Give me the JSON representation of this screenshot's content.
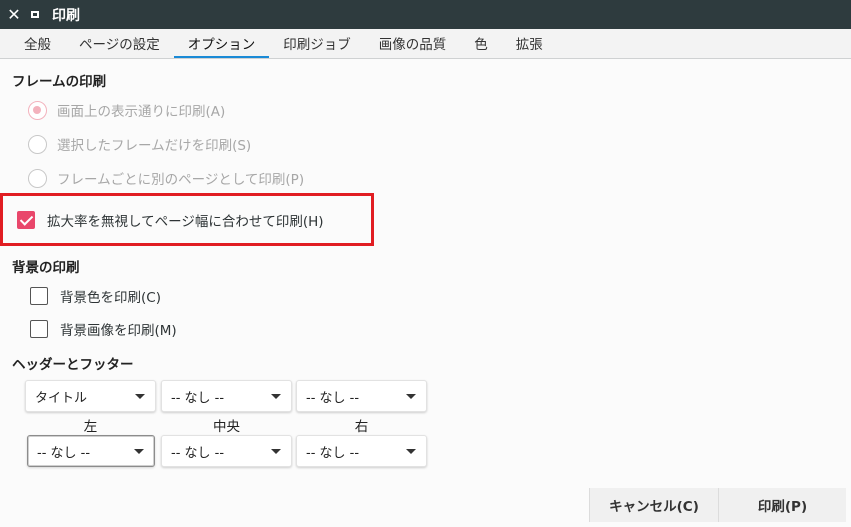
{
  "window": {
    "title": "印刷"
  },
  "tabs": [
    {
      "label": "全般"
    },
    {
      "label": "ページの設定"
    },
    {
      "label": "オプション"
    },
    {
      "label": "印刷ジョブ"
    },
    {
      "label": "画像の品質"
    },
    {
      "label": "色"
    },
    {
      "label": "拡張"
    }
  ],
  "frames": {
    "title": "フレームの印刷",
    "options": [
      {
        "label": "画面上の表示通りに印刷(A)",
        "checked": true
      },
      {
        "label": "選択したフレームだけを印刷(S)",
        "checked": false
      },
      {
        "label": "フレームごとに別のページとして印刷(P)",
        "checked": false
      }
    ]
  },
  "shrink_to_fit": {
    "label": "拡大率を無視してページ幅に合わせて印刷(H)",
    "checked": true
  },
  "background": {
    "title": "背景の印刷",
    "colors_label": "背景色を印刷(C)",
    "images_label": "背景画像を印刷(M)"
  },
  "header_footer": {
    "title": "ヘッダーとフッター",
    "header": [
      "タイトル",
      "-- なし --",
      "-- なし --"
    ],
    "columns": [
      "左",
      "中央",
      "右"
    ],
    "footer": [
      "-- なし --",
      "-- なし --",
      "-- なし --"
    ]
  },
  "buttons": {
    "cancel": "キャンセル(C)",
    "print": "印刷(P)"
  }
}
